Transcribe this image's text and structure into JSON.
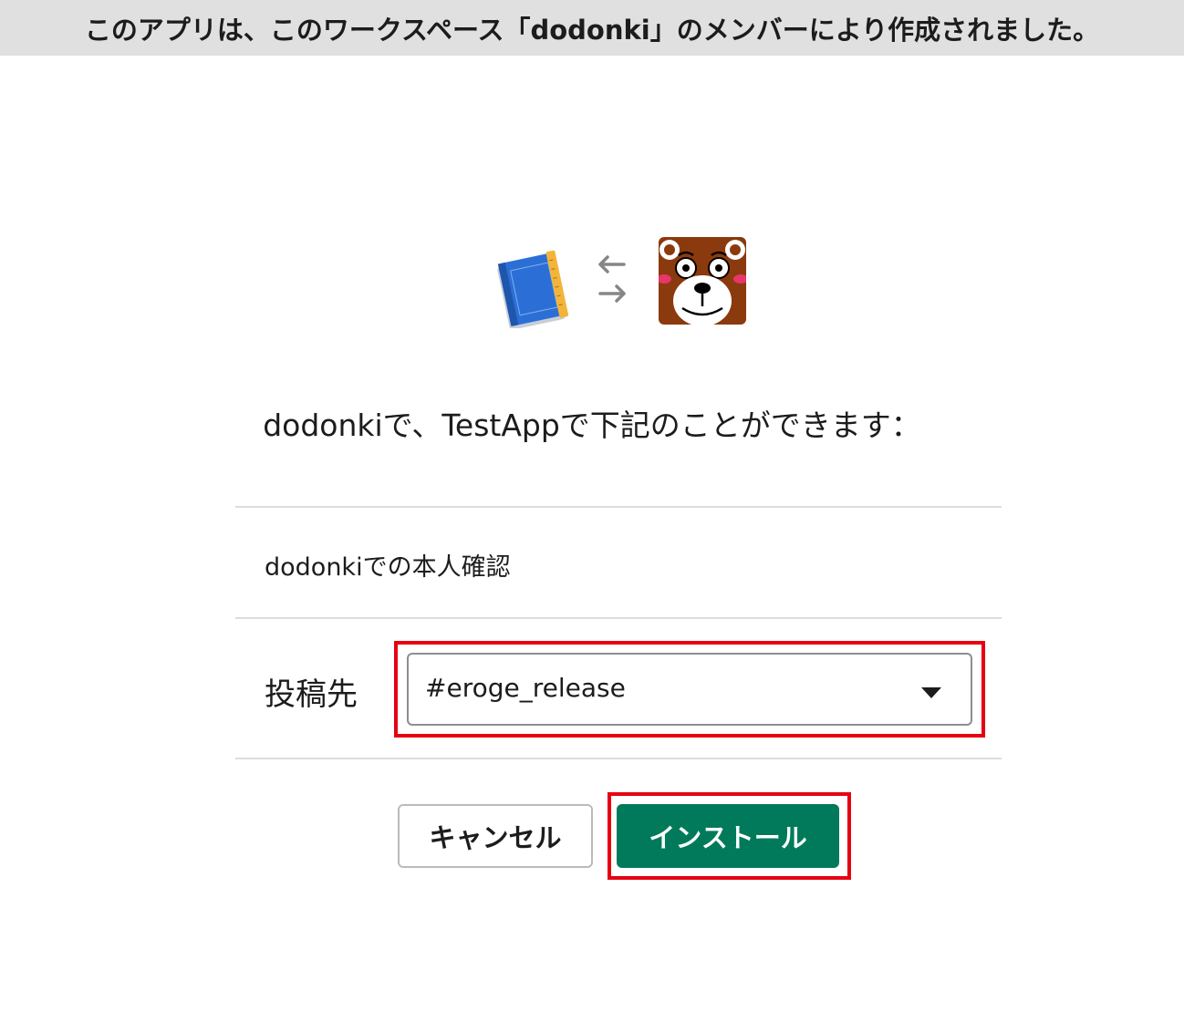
{
  "banner": {
    "text": "このアプリは、このワークスペース「dodonki」のメンバーにより作成されました。"
  },
  "icons": {
    "app_icon": "xcode-blueprint-icon",
    "exchange_icon": "exchange-arrows-icon",
    "workspace_icon": "bear-face-icon"
  },
  "heading": "dodonkiで、TestAppで下記のことができます：",
  "permission": "dodonkiでの本人確認",
  "post_to": {
    "label": "投稿先",
    "selected_channel": "#eroge_release"
  },
  "buttons": {
    "cancel": "キャンセル",
    "install": "インストール"
  },
  "colors": {
    "banner_bg": "#e0e0e0",
    "install_bg": "#007a5a",
    "highlight": "#e60012",
    "bear_brown": "#8b3a0e"
  }
}
